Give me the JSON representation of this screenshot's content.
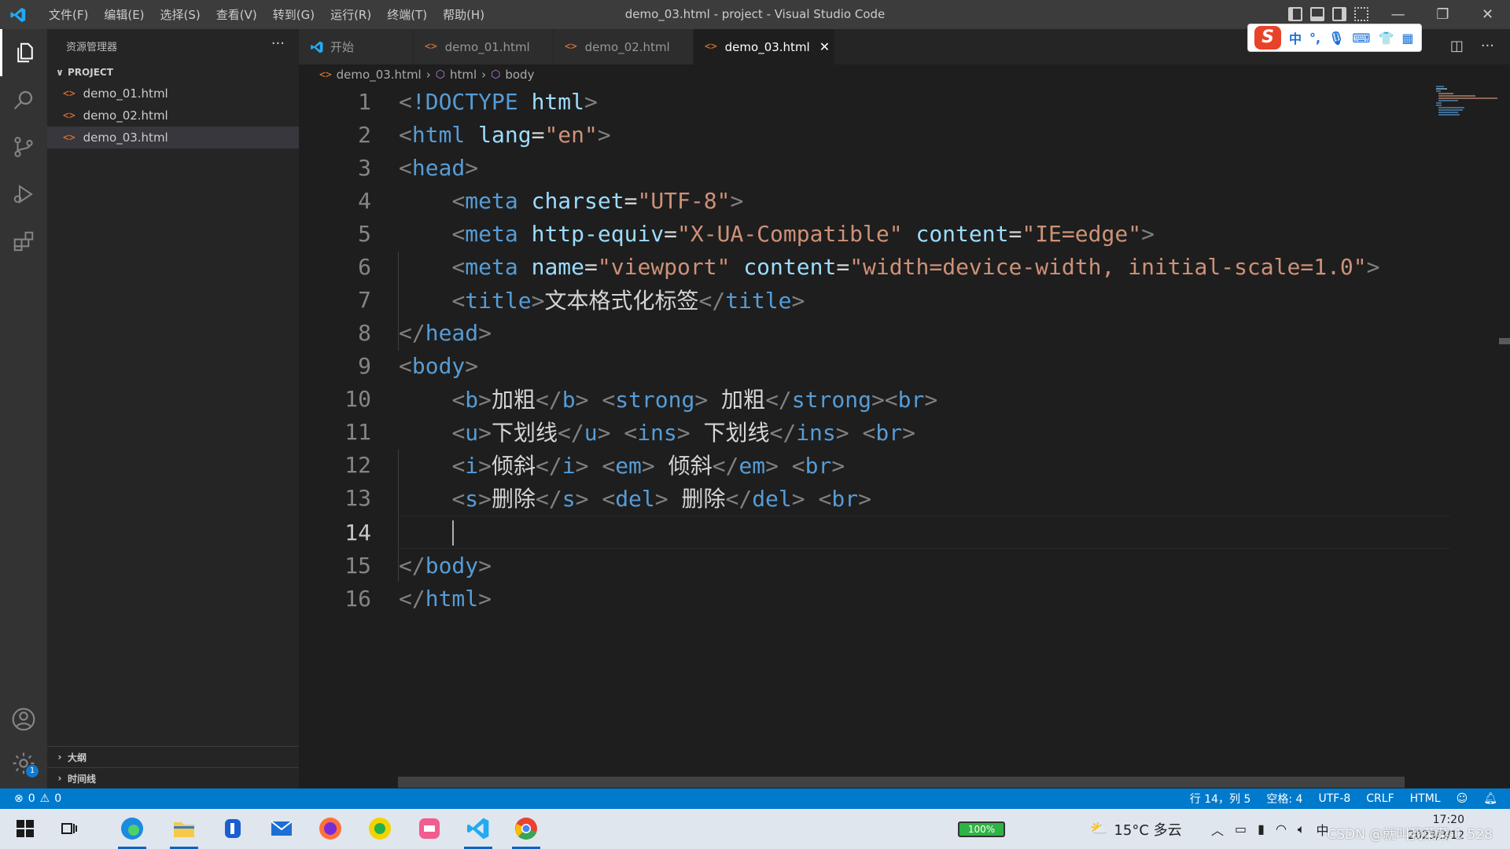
{
  "titlebar": {
    "menus": [
      "文件(F)",
      "编辑(E)",
      "选择(S)",
      "查看(V)",
      "转到(G)",
      "运行(R)",
      "终端(T)",
      "帮助(H)"
    ],
    "title": "demo_03.html - project - Visual Studio Code"
  },
  "sidebar": {
    "header": "资源管理器",
    "more": "···",
    "project_label": "PROJECT",
    "files": [
      "demo_01.html",
      "demo_02.html",
      "demo_03.html"
    ],
    "outline_label": "大纲",
    "timeline_label": "时间线"
  },
  "activity": {
    "settings_badge": "1"
  },
  "tabs": [
    {
      "label": "开始"
    },
    {
      "label": "demo_01.html"
    },
    {
      "label": "demo_02.html"
    },
    {
      "label": "demo_03.html"
    }
  ],
  "ime": {
    "lang": "中"
  },
  "breadcrumb": {
    "file": "demo_03.html",
    "html": "html",
    "body": "body"
  },
  "editor": {
    "line_numbers": [
      "1",
      "2",
      "3",
      "4",
      "5",
      "6",
      "7",
      "8",
      "9",
      "10",
      "11",
      "12",
      "13",
      "14",
      "15",
      "16"
    ],
    "current_line": "14"
  },
  "statusbar": {
    "errors": "0",
    "warnings": "0",
    "position": "行 14，列 5",
    "spaces": "空格: 4",
    "encoding": "UTF-8",
    "eol": "CRLF",
    "language": "HTML"
  },
  "taskbar": {
    "battery": "100%",
    "weather": "15°C  多云",
    "time": "17:20",
    "date": "2023/3/12",
    "watermark": "CSDN @就叫我菜菜-1 528"
  },
  "colors": {
    "accent": "#007acc",
    "tag": "#569cd6",
    "attr": "#9cdcfe",
    "string": "#ce9178",
    "file_icon": "#e37933"
  }
}
